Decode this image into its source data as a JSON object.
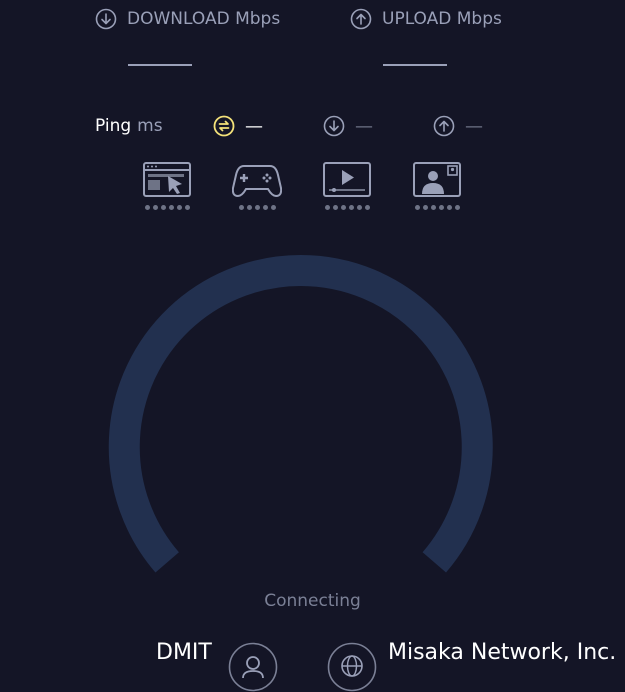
{
  "download": {
    "label": "DOWNLOAD Mbps",
    "value": "—"
  },
  "upload": {
    "label": "UPLOAD Mbps",
    "value": "—"
  },
  "ping": {
    "label": "Ping",
    "unit": "ms",
    "idle": "—",
    "download": "—",
    "upload": "—"
  },
  "apps": [
    "web-browsing-icon",
    "gaming-icon",
    "video-streaming-icon",
    "video-call-icon"
  ],
  "gauge": {
    "status": "Connecting",
    "track_color": "#22304f"
  },
  "provider": {
    "host": "DMIT",
    "isp": "Misaka Network, Inc."
  },
  "colors": {
    "background": "#141526",
    "ping_accent": "#f4e27a",
    "muted": "#9aa0b8"
  }
}
